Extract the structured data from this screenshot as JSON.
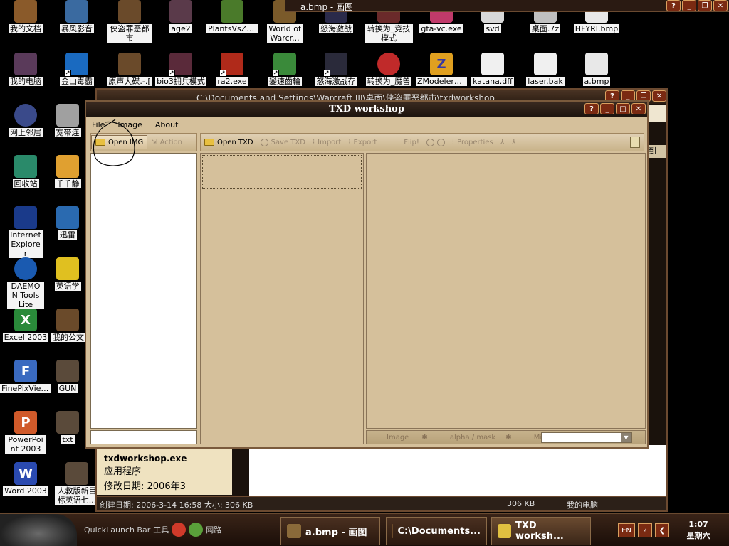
{
  "desktop": {
    "icons": [
      {
        "label": "我的文档"
      },
      {
        "label": "暴风影音"
      },
      {
        "label": "侠盗罪恶都市"
      },
      {
        "label": "age2"
      },
      {
        "label": "PlantsVsZo..."
      },
      {
        "label": "World of Warcr..."
      },
      {
        "label": "怒海激战"
      },
      {
        "label": "转换为_竞技模式"
      },
      {
        "label": "gta-vc.exe"
      },
      {
        "label": "svd"
      },
      {
        "label": "桌面.7z"
      },
      {
        "label": "HFYRI.bmp"
      },
      {
        "label": "我的电脑"
      },
      {
        "label": "金山毒霸"
      },
      {
        "label": "原声大碟.-.["
      },
      {
        "label": "bio3拥兵模式"
      },
      {
        "label": "ra2.exe"
      },
      {
        "label": "變速齒輪"
      },
      {
        "label": "怒海激战存"
      },
      {
        "label": "转换为_魔兽"
      },
      {
        "label": "ZModeler2...."
      },
      {
        "label": "katana.dff"
      },
      {
        "label": "laser.bak"
      },
      {
        "label": "a.bmp"
      },
      {
        "label": "网上邻居"
      },
      {
        "label": "宽带连"
      },
      {
        "label": "回收站"
      },
      {
        "label": "千千静"
      },
      {
        "label": "Internet Explorer"
      },
      {
        "label": "迅雷"
      },
      {
        "label": "DAEMON Tools Lite"
      },
      {
        "label": "英语学"
      },
      {
        "label": "Excel 2003"
      },
      {
        "label": "我的公文"
      },
      {
        "label": "FinePixViewer"
      },
      {
        "label": "GUN"
      },
      {
        "label": "PowerPoint 2003"
      },
      {
        "label": "txt"
      },
      {
        "label": "Word 2003"
      },
      {
        "label": "人教版新目标英语七..."
      }
    ]
  },
  "top_window": {
    "title": "a.bmp - 画图"
  },
  "explorer": {
    "title": "C:\\Documents and Settings\\Warcraft III\\桌面\\侠盗罪恶都市\\txdworkshop",
    "file_name": "txdworkshop.exe",
    "file_type": "应用程序",
    "modified": "修改日期: 2006年3",
    "status_left": "创建日期: 2006-3-14 16:58 大小: 306 KB",
    "status_size": "306 KB",
    "status_location": "我的电脑",
    "edge_text": "到"
  },
  "txd": {
    "title": "TXD workshop",
    "menu": {
      "file": "File",
      "image": "Image",
      "about": "About"
    },
    "toolbar_left": {
      "open_img": "Open IMG",
      "action": "Action"
    },
    "toolbar_main": {
      "open_txd": "Open TXD",
      "save_txd": "Save TXD",
      "import": "Import",
      "export": "Export",
      "flip": "Flip!",
      "properties": "Properties"
    },
    "preview_tabs": {
      "image": "Image",
      "alpha": "alpha / mask",
      "mixed": "Mixed View"
    }
  },
  "taskbar": {
    "quicklaunch_1": "QuickLaunch Bar",
    "quicklaunch_2": "工具",
    "quicklaunch_3": "网路",
    "tasks": [
      {
        "label": "a.bmp - 画图"
      },
      {
        "label": "C:\\Documents..."
      },
      {
        "label": "TXD worksh..."
      }
    ],
    "lang": "EN",
    "help": "?",
    "time": "1:07",
    "day": "星期六"
  }
}
